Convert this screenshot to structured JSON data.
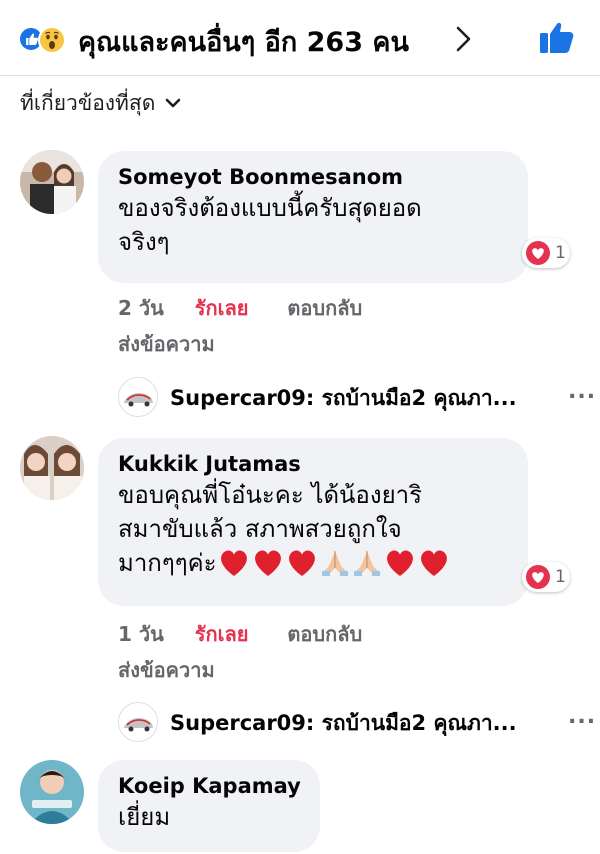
{
  "reactions": {
    "summary_text": "คุณและคนอื่นๆ อีก 263 คน",
    "icons": [
      "like-icon",
      "wow-icon"
    ],
    "like_button_icon": "thumbs-up-icon",
    "colors": {
      "like": "#1b74e4",
      "wow": "#f7c744",
      "love": "#e4334f"
    }
  },
  "sort": {
    "label": "ที่เกี่ยวข้องที่สุด"
  },
  "comments": [
    {
      "author": "Someyot Boonmesanom",
      "text_line1": "ของจริงต้องแบบนี้ครับสุดยอด",
      "text_line2": "จริงๆ",
      "reaction_count": "1",
      "time": "2 วัน",
      "love_label": "รักเลย",
      "reply_label": "ตอบกลับ",
      "message_label": "ส่งข้อความ",
      "reply_preview": {
        "text": "Supercar09: รถบ้านมือ2 คุณภา...",
        "more": "..."
      }
    },
    {
      "author": "Kukkik Jutamas",
      "text_line1": "ขอบคุณพี่โอ๋นะคะ ได้น้องยาริ",
      "text_line2": "สมาขับแล้ว สภาพสวยถูกใจ",
      "text_line3": "มากๆๆค่ะ",
      "emoji_icons": [
        "heart-emoji",
        "heart-emoji",
        "heart-emoji",
        "praying-hands-emoji",
        "praying-hands-emoji",
        "heart-emoji",
        "heart-emoji"
      ],
      "reaction_count": "1",
      "time": "1 วัน",
      "love_label": "รักเลย",
      "reply_label": "ตอบกลับ",
      "message_label": "ส่งข้อความ",
      "reply_preview": {
        "text": "Supercar09: รถบ้านมือ2 คุณภา...",
        "more": "..."
      }
    },
    {
      "author": "Koeip Kapamay",
      "text_line1": "เยี่ยม"
    }
  ]
}
